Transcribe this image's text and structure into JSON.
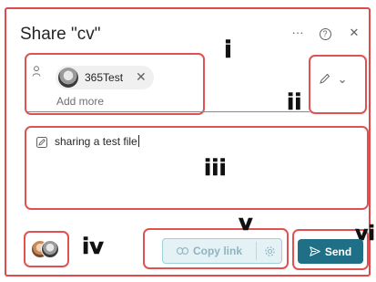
{
  "dialog": {
    "title": "Share \"cv\"",
    "more_icon": "···",
    "help_icon": "?",
    "close_icon": "✕"
  },
  "recipients": {
    "chip_name": "365Test",
    "chip_remove_icon": "✕",
    "add_more": "Add more"
  },
  "permission": {
    "edit_icon": "pencil-icon",
    "chevron": "⌄"
  },
  "message": {
    "value": "sharing a test file"
  },
  "footer": {
    "copy_link_label": "Copy link",
    "send_label": "Send"
  },
  "annotations": {
    "i": "i",
    "ii": "ii",
    "iii": "iii",
    "iv": "iv",
    "v": "v",
    "vi": "vi"
  },
  "colors": {
    "annotation_box": "#e05252",
    "send_bg": "#1f6f86",
    "copy_bg": "#e4f2f6"
  }
}
